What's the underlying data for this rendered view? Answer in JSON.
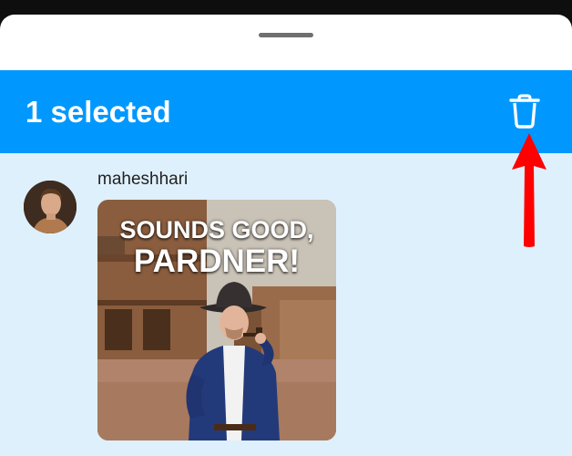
{
  "header": {
    "selection_title": "1 selected",
    "delete_icon": "trash-icon"
  },
  "message": {
    "sender_name": "maheshhari",
    "avatar_icon": "user-avatar"
  },
  "gif": {
    "caption_line_1": "SOUNDS GOOD,",
    "caption_line_2": "PARDNER!"
  },
  "colors": {
    "accent": "#0098fe",
    "selected_background": "#dff0fd",
    "annotation": "#ff0000"
  }
}
